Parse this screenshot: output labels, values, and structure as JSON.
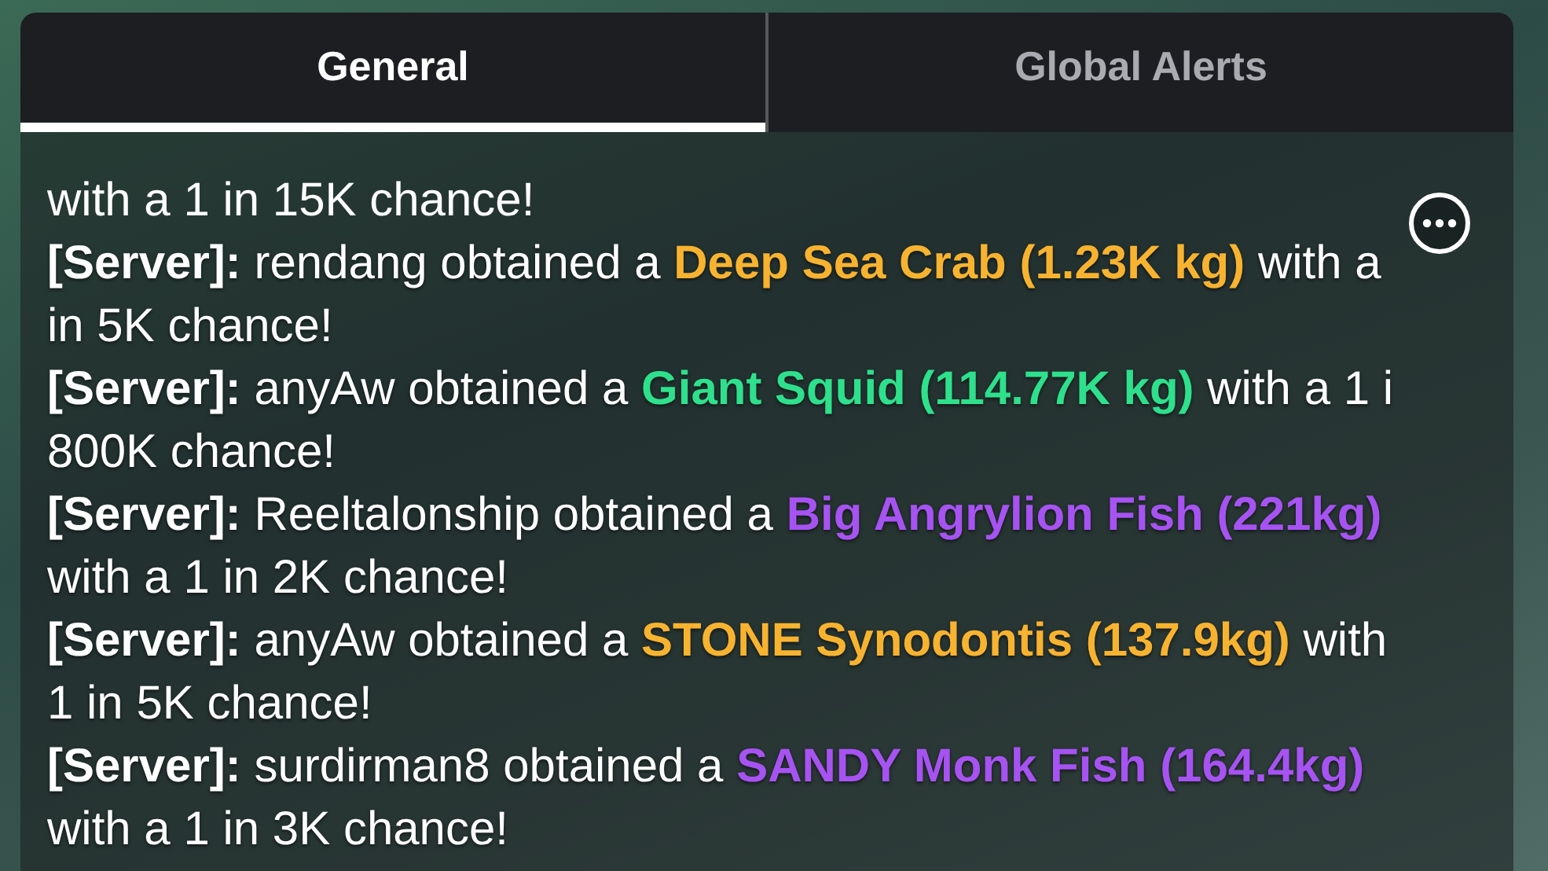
{
  "tabs": [
    {
      "label": "General",
      "selected": true
    },
    {
      "label": "Global Alerts",
      "selected": false
    }
  ],
  "partial_line": "with a 1 in 15K chance!",
  "messages": [
    {
      "speaker": "[Server]:",
      "text": "rendang obtained a",
      "item": "Deep Sea Crab (1.23K kg)",
      "color": "#f7b330",
      "line_end": "with a",
      "continuation": "in 5K chance!"
    },
    {
      "speaker": "[Server]:",
      "text": "anyAw obtained a",
      "item": "Giant Squid (114.77K kg)",
      "color": "#2ee08c",
      "line_end": "with a 1 i",
      "continuation": "800K chance!"
    },
    {
      "speaker": "[Server]:",
      "text": "Reeltalonship obtained a",
      "item": "Big Angrylion Fish (221kg)",
      "color": "#a653f2",
      "continuation": "with a 1 in 2K chance!"
    },
    {
      "speaker": "[Server]:",
      "text": "anyAw obtained a",
      "item": "STONE Synodontis (137.9kg)",
      "color": "#f7b330",
      "line_end": "with",
      "continuation": "1 in 5K chance!"
    },
    {
      "speaker": "[Server]:",
      "text": "surdirman8 obtained a",
      "item": "SANDY Monk Fish (164.4kg)",
      "color": "#a653f2",
      "continuation": "with a 1 in 3K chance!"
    }
  ]
}
